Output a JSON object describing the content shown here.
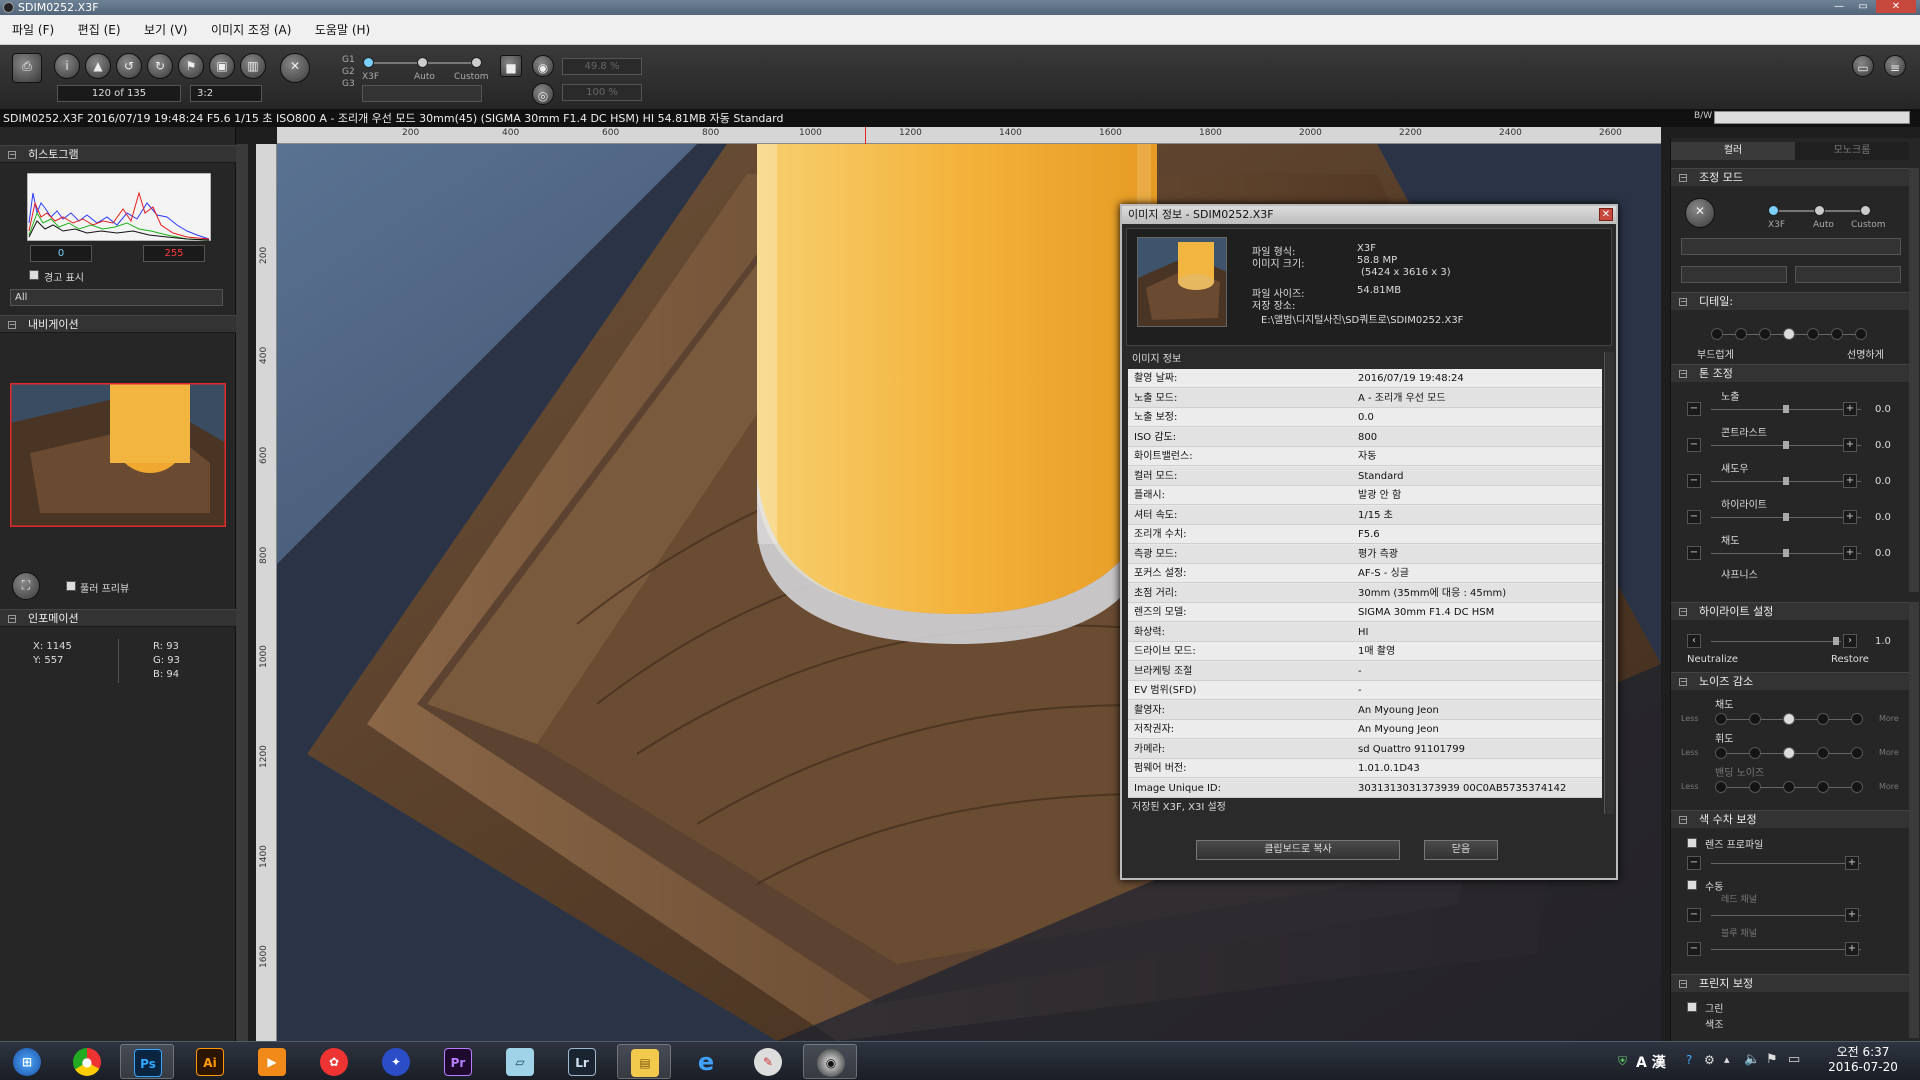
{
  "window": {
    "title": "SDIM0252.X3F",
    "min": "—",
    "max": "▭",
    "close": "✕"
  },
  "menu": [
    "파일 (F)",
    "편집 (E)",
    "보기 (V)",
    "이미지 조정 (A)",
    "도움말 (H)"
  ],
  "toolbar": {
    "counter": "120 of 135",
    "ratio": "3:2",
    "slider_labels": {
      "x3f": "X3F",
      "auto": "Auto",
      "custom": "Custom"
    },
    "groups": [
      "G1",
      "G2",
      "G3"
    ],
    "zoom1": "49.8 %",
    "zoom2": "100 %"
  },
  "infobar": "SDIM0252.X3F 2016/07/19 19:48:24 F5.6 1/15 초 ISO800 A - 조리개 우선 모드 30mm(45) (SIGMA 30mm F1.4 DC HSM) HI 54.81MB 자동 Standard",
  "bw_label": "B/W",
  "left": {
    "histogram": "히스토그램",
    "hist_min": "0",
    "hist_max": "255",
    "warning": "경고 표시",
    "channel": "All",
    "navigation": "내비게이션",
    "full_preview": "풀러 프리뷰",
    "information": "인포메이션",
    "x": "X:  1145",
    "y": "Y:  557",
    "r": "R:  93",
    "g": "G:  93",
    "b": "B:  94"
  },
  "ruler": [
    "200",
    "400",
    "600",
    "800",
    "1000",
    "1200",
    "1400",
    "1600",
    "1800",
    "2000",
    "2200",
    "2400",
    "2600"
  ],
  "ruler_v": [
    "200",
    "400",
    "600",
    "800",
    "1000",
    "1200",
    "1400",
    "1600"
  ],
  "dialog": {
    "title": "이미지 정보 - SDIM0252.X3F",
    "file": [
      {
        "k": "파일 형식:",
        "v": "X3F"
      },
      {
        "k": "이미지 크기:",
        "v": "58.8 MP"
      },
      {
        "k": "",
        "v": "(5424 x 3616 x 3)"
      },
      {
        "k": "파일 사이즈:",
        "v": "54.81MB"
      },
      {
        "k": "저장 장소:",
        "v": ""
      }
    ],
    "path": "E:\\앨범\\디지털사진\\SD쿼트로\\SDIM0252.X3F",
    "section": "이미지 정보",
    "rows": [
      {
        "k": "촬영 날짜:",
        "v": "2016/07/19 19:48:24"
      },
      {
        "k": "노출 모드:",
        "v": "A - 조리개 우선 모드"
      },
      {
        "k": "노출 보정:",
        "v": "0.0"
      },
      {
        "k": "ISO 감도:",
        "v": "800"
      },
      {
        "k": "화이트밸런스:",
        "v": "자동"
      },
      {
        "k": "컬러 모드:",
        "v": "Standard"
      },
      {
        "k": "플래시:",
        "v": "발광 안 함"
      },
      {
        "k": "셔터 속도:",
        "v": "1/15 초"
      },
      {
        "k": "조리개 수치:",
        "v": "F5.6"
      },
      {
        "k": "측광 모드:",
        "v": "평가 측광"
      },
      {
        "k": "포커스 설정:",
        "v": "AF-S - 싱글"
      },
      {
        "k": "초점 거리:",
        "v": "30mm (35mm에 대응 : 45mm)"
      },
      {
        "k": "렌즈의 모델:",
        "v": "SIGMA 30mm F1.4 DC HSM"
      },
      {
        "k": "화상력:",
        "v": "HI"
      },
      {
        "k": "드라이브 모드:",
        "v": "1매 촬영"
      },
      {
        "k": "브라케팅 조절",
        "v": "-"
      },
      {
        "k": "EV 범위(SFD)",
        "v": "-"
      },
      {
        "k": "촬영자:",
        "v": "An Myoung Jeon"
      },
      {
        "k": "저작권자:",
        "v": "An Myoung Jeon"
      },
      {
        "k": "카메라:",
        "v": "sd Quattro 91101799"
      },
      {
        "k": "펌웨어 버전:",
        "v": "1.01.0.1D43"
      },
      {
        "k": "Image Unique ID:",
        "v": "3031313031373939 00C0AB5735374142"
      }
    ],
    "footer": "저장된 X3F, X3I 설정",
    "copy_btn": "클립보드로 복사",
    "ok_btn": "닫음"
  },
  "right": {
    "tab_color": "컬러",
    "tab_mono": "모노크롬",
    "adjust_mode": "조정 모드",
    "mode_labels": {
      "x3f": "X3F",
      "auto": "Auto",
      "custom": "Custom"
    },
    "detail": "디테일:",
    "soft": "부드럽게",
    "sharp": "선명하게",
    "tone": "톤 조정",
    "tone_items": [
      {
        "label": "노출",
        "value": "0.0"
      },
      {
        "label": "콘트라스트",
        "value": "0.0"
      },
      {
        "label": "섀도우",
        "value": "0.0"
      },
      {
        "label": "하이라이트",
        "value": "0.0"
      },
      {
        "label": "채도",
        "value": "0.0"
      }
    ],
    "sharpness": "샤프니스",
    "highlight": "하이라이트 설정",
    "hl_value": "1.0",
    "neutralize": "Neutralize",
    "restore": "Restore",
    "noise": "노이즈 감소",
    "chroma": "채도",
    "luma": "휘도",
    "band": "밴딩 노이즈",
    "less": "Less",
    "more": "More",
    "color_corr": "색 수차 보정",
    "lens_profile": "렌즈 프로파일",
    "manual": "수동",
    "red_ch": "레드 채널",
    "blue_ch": "블루 채널",
    "fringe": "프린지 보정",
    "green": "그린",
    "tint": "색조"
  },
  "taskbar": {
    "icons": [
      "windows-start-icon",
      "chrome-icon",
      "photoshop-icon",
      "illustrator-icon",
      "media-player-icon",
      "camera-app-icon",
      "browser-compass-icon",
      "premiere-icon",
      "notes-icon",
      "lightroom-icon",
      "folder-icon",
      "internet-explorer-icon",
      "paint-icon",
      "sigma-photo-pro-icon"
    ],
    "ps": "Ps",
    "ai": "Ai",
    "pr": "Pr",
    "lr": "Lr",
    "ime": "A 漢",
    "time": "오전 6:37",
    "date": "2016-07-20"
  },
  "colors": {
    "accent": "#7ad0ff",
    "nav_frame": "#e02a2a"
  }
}
